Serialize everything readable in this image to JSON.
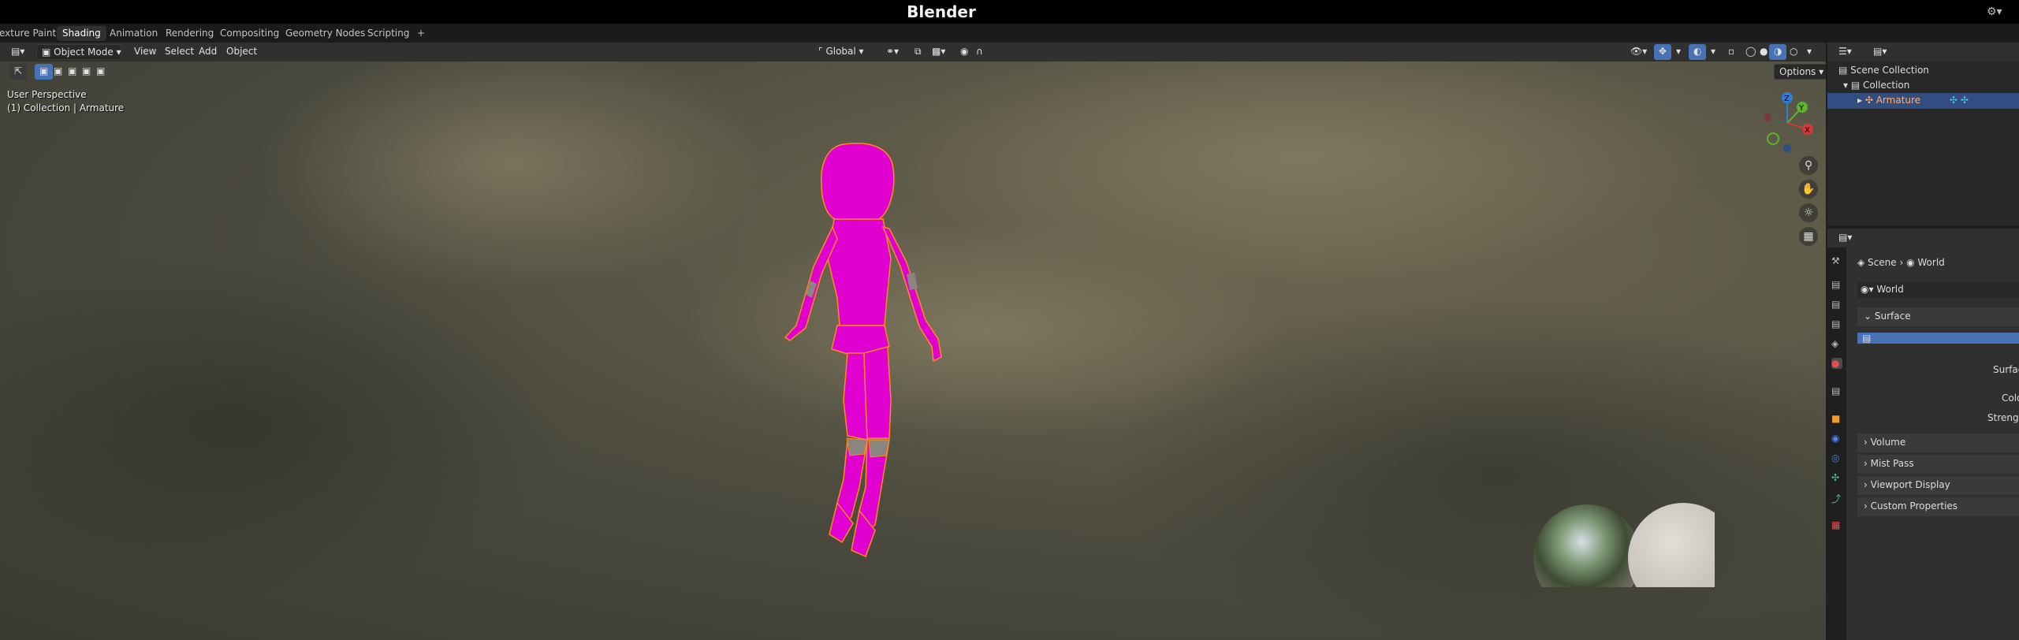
{
  "window": {
    "title": "Blender"
  },
  "workspace_tabs": [
    {
      "label": "exture Paint"
    },
    {
      "label": "Shading",
      "active": true
    },
    {
      "label": "Animation"
    },
    {
      "label": "Rendering"
    },
    {
      "label": "Compositing"
    },
    {
      "label": "Geometry Nodes"
    },
    {
      "label": "Scripting"
    },
    {
      "label": "+"
    }
  ],
  "viewport_header": {
    "mode": "Object Mode",
    "menus": [
      "View",
      "Select",
      "Add",
      "Object"
    ],
    "orientation": "Global",
    "options_label": "Options"
  },
  "viewport": {
    "perspective_label": "User Perspective",
    "collection_label": "(1) Collection | Armature",
    "gizmo": {
      "z": "Z",
      "y": "Y",
      "x": "X"
    },
    "selected_color": "#e600d2",
    "outline_color": "#ff8a1a"
  },
  "outliner": {
    "items": [
      {
        "label": "Scene Collection"
      },
      {
        "label": "Collection"
      },
      {
        "label": "Armature",
        "selected": true
      }
    ]
  },
  "properties": {
    "breadcrumb": {
      "scene": "Scene",
      "world": "World"
    },
    "world_field": "World",
    "panels": {
      "surface": "Surface",
      "surface_label": "Surface",
      "color_label": "Colo",
      "strength_label": "Strength",
      "volume": "Volume",
      "mist_pass": "Mist Pass",
      "viewport_display": "Viewport Display",
      "custom_properties": "Custom Properties"
    },
    "accent_color": "#4772b3"
  }
}
